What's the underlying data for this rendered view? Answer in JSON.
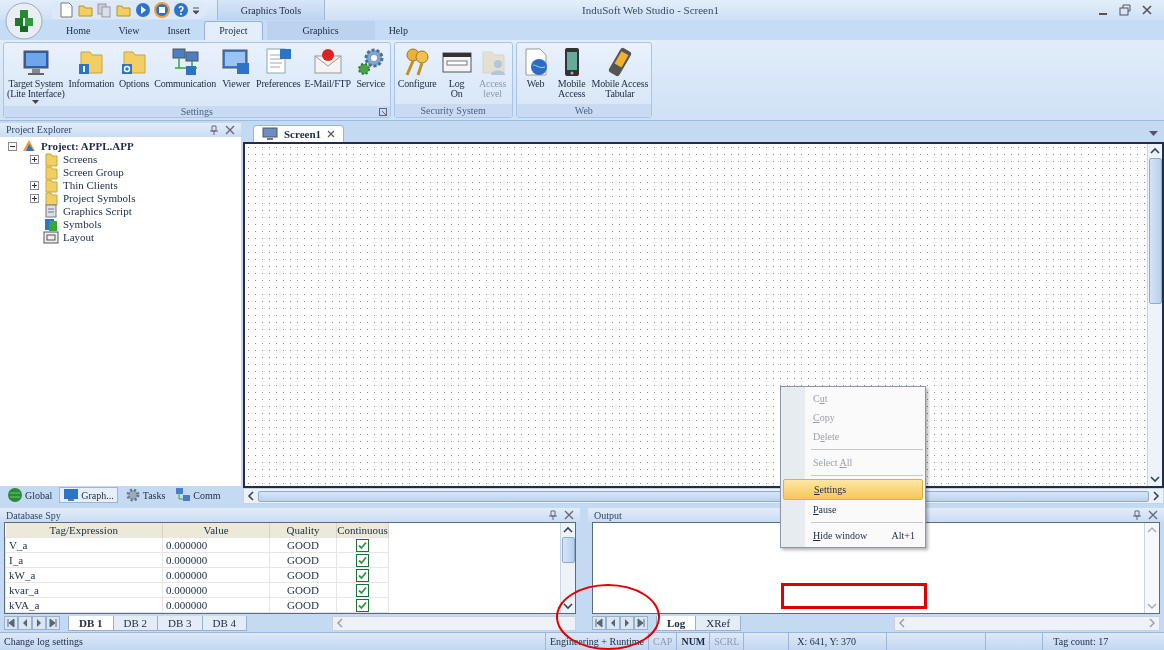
{
  "window": {
    "title": "InduSoft Web Studio - Screen1",
    "contextual_group": "Graphics Tools"
  },
  "ribbon_tabs": [
    {
      "label": "Home",
      "selected": false
    },
    {
      "label": "View",
      "selected": false
    },
    {
      "label": "Insert",
      "selected": false
    },
    {
      "label": "Project",
      "selected": true
    },
    {
      "label": "Graphics",
      "selected": false,
      "contextual": true
    },
    {
      "label": "Help",
      "selected": false
    }
  ],
  "ribbon_groups": [
    {
      "title": "Settings",
      "launcher": true,
      "buttons": [
        {
          "label": "Target System\n(Lite Interface)",
          "dropdown": true,
          "disabled": false
        },
        {
          "label": "Information",
          "disabled": false
        },
        {
          "label": "Options",
          "disabled": false
        },
        {
          "label": "Communication",
          "disabled": false
        },
        {
          "label": "Viewer",
          "disabled": false
        },
        {
          "label": "Preferences",
          "disabled": false
        },
        {
          "label": "E-Mail/FTP",
          "disabled": false
        },
        {
          "label": "Service",
          "disabled": false
        }
      ]
    },
    {
      "title": "Security System",
      "buttons": [
        {
          "label": "Configure",
          "disabled": false
        },
        {
          "label": "Log\nOn",
          "disabled": false
        },
        {
          "label": "Access\nlevel",
          "disabled": true
        }
      ]
    },
    {
      "title": "Web",
      "buttons": [
        {
          "label": "Web",
          "disabled": false
        },
        {
          "label": "Mobile\nAccess",
          "disabled": false
        },
        {
          "label": "Mobile Access\nTabular",
          "disabled": false
        }
      ]
    }
  ],
  "project_explorer": {
    "title": "Project Explorer",
    "tree": [
      {
        "label": "Project: APPL.APP",
        "expanded": true,
        "children": [
          {
            "label": "Screens",
            "expanded": false
          },
          {
            "label": "Screen Group"
          },
          {
            "label": "Thin Clients",
            "expanded": false
          },
          {
            "label": "Project Symbols",
            "expanded": false
          },
          {
            "label": "Graphics Script"
          },
          {
            "label": "Symbols"
          },
          {
            "label": "Layout"
          }
        ]
      }
    ],
    "tabs": [
      {
        "label": "Global",
        "selected": false
      },
      {
        "label": "Graph...",
        "selected": true
      },
      {
        "label": "Tasks",
        "selected": false
      },
      {
        "label": "Comm",
        "selected": false
      }
    ]
  },
  "document_tabs": [
    {
      "label": "Screen1",
      "selected": true
    }
  ],
  "context_menu": [
    {
      "pre": "C",
      "key": "u",
      "post": "t",
      "disabled": true,
      "selected": false
    },
    {
      "key": "C",
      "post": "opy",
      "disabled": true,
      "selected": false
    },
    {
      "pre": "D",
      "key": "e",
      "post": "lete",
      "disabled": true,
      "selected": false
    },
    {
      "kind": "separator"
    },
    {
      "pre": "Select ",
      "key": "A",
      "post": "ll",
      "disabled": true,
      "selected": false
    },
    {
      "kind": "separator"
    },
    {
      "key": "S",
      "post": "ettings",
      "disabled": false,
      "selected": true
    },
    {
      "key": "P",
      "post": "ause",
      "disabled": false,
      "selected": false
    },
    {
      "kind": "separator"
    },
    {
      "key": "H",
      "post": "ide window",
      "shortcut": "Alt+1",
      "disabled": false,
      "selected": false
    }
  ],
  "database_spy": {
    "title": "Database Spy",
    "columns": [
      "Tag/Expression",
      "Value",
      "Quality",
      "Continuous"
    ],
    "rows": [
      {
        "tag": "V_a",
        "value": "0.000000",
        "quality": "GOOD",
        "continuous": true
      },
      {
        "tag": "I_a",
        "value": "0.000000",
        "quality": "GOOD",
        "continuous": true
      },
      {
        "tag": "kW_a",
        "value": "0.000000",
        "quality": "GOOD",
        "continuous": true
      },
      {
        "tag": "kvar_a",
        "value": "0.000000",
        "quality": "GOOD",
        "continuous": true
      },
      {
        "tag": "kVA_a",
        "value": "0.000000",
        "quality": "GOOD",
        "continuous": true
      }
    ],
    "tabs": [
      {
        "label": "DB 1",
        "selected": true
      },
      {
        "label": "DB 2",
        "selected": false
      },
      {
        "label": "DB 3",
        "selected": false
      },
      {
        "label": "DB 4",
        "selected": false
      }
    ]
  },
  "output": {
    "title": "Output",
    "tabs": [
      {
        "label": "Log",
        "selected": true
      },
      {
        "label": "XRef",
        "selected": false
      }
    ]
  },
  "status_bar": {
    "message": "Change log settings",
    "mode": "Engineering + Runtime",
    "indicators": [
      {
        "label": "CAP",
        "on": false
      },
      {
        "label": "NUM",
        "on": true
      },
      {
        "label": "SCRL",
        "on": false
      }
    ],
    "position": "X: 641, Y: 370",
    "tag_count": "Tag count: 17"
  }
}
